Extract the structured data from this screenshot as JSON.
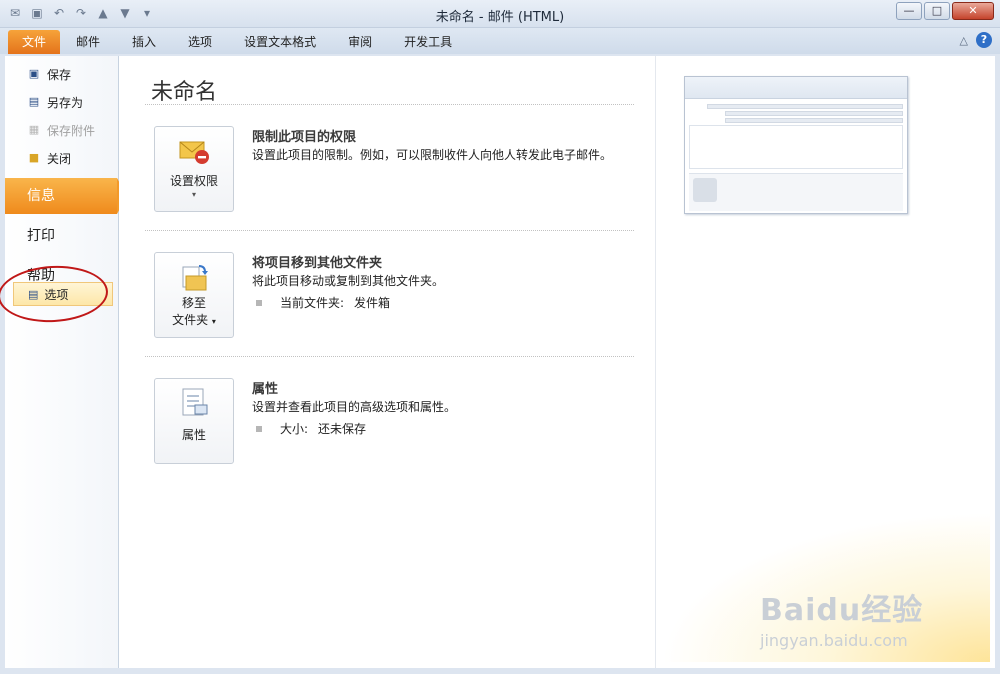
{
  "window": {
    "title": "未命名 - 邮件 (HTML)",
    "buttons": {
      "minimize": "—",
      "maximize": "□",
      "close": "✕"
    }
  },
  "quick_access": [
    "outlook-icon",
    "save-icon",
    "undo-icon",
    "redo-icon",
    "up-icon",
    "down-icon",
    "customize-icon"
  ],
  "ribbon": {
    "tabs": [
      "文件",
      "邮件",
      "插入",
      "选项",
      "设置文本格式",
      "审阅",
      "开发工具"
    ],
    "active_tab": "文件",
    "help_glyph": "?",
    "minimize_glyph": "△"
  },
  "backstage_nav": {
    "commands": [
      {
        "label": "保存",
        "icon": "save-icon",
        "disabled": false
      },
      {
        "label": "另存为",
        "icon": "save-as-icon",
        "disabled": false
      },
      {
        "label": "保存附件",
        "icon": "save-attachments-icon",
        "disabled": true
      },
      {
        "label": "关闭",
        "icon": "folder-close-icon",
        "disabled": false
      }
    ],
    "categories": [
      {
        "label": "信息",
        "active": true
      },
      {
        "label": "打印",
        "active": false
      },
      {
        "label": "帮助",
        "active": false
      }
    ],
    "options_label": "选项"
  },
  "info": {
    "title": "未命名",
    "sections": [
      {
        "button_label_1": "设置权限",
        "button_label_2": "",
        "has_dropdown": true,
        "icon": "envelope-restrict-icon",
        "heading": "限制此项目的权限",
        "description": "设置此项目的限制。例如，可以限制收件人向他人转发此电子邮件。",
        "bullet_label": "",
        "bullet_value": ""
      },
      {
        "button_label_1": "移至",
        "button_label_2": "文件夹",
        "has_dropdown": true,
        "icon": "move-folder-icon",
        "heading": "将项目移到其他文件夹",
        "description": "将此项目移动或复制到其他文件夹。",
        "bullet_label": "当前文件夹:",
        "bullet_value": "发件箱"
      },
      {
        "button_label_1": "属性",
        "button_label_2": "",
        "has_dropdown": false,
        "icon": "properties-icon",
        "heading": "属性",
        "description": "设置并查看此项目的高级选项和属性。",
        "bullet_label": "大小:",
        "bullet_value": "还未保存"
      }
    ]
  },
  "watermark": {
    "logo": "Baidu经验",
    "url": "jingyan.baidu.com"
  },
  "colors": {
    "accent_orange": "#ef8a1c",
    "annotation_red": "#c01818",
    "help_blue": "#2f6fc7"
  }
}
